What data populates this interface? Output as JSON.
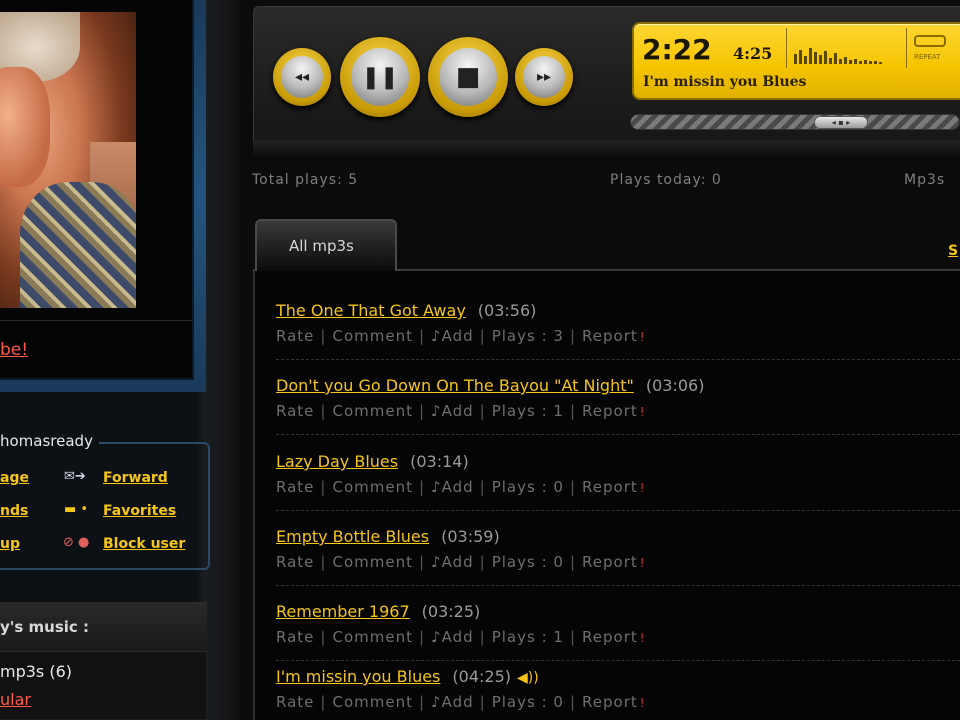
{
  "profile": {
    "photo_link": "be!",
    "username_fragment": "homasready",
    "actions": {
      "message": "age",
      "forward": "Forward",
      "friends": "nds",
      "favorites": "Favorites",
      "group": "up",
      "block": "Block user"
    },
    "music_title": "y's music :",
    "mp3s_count": "mp3s (6)",
    "popular": "ular"
  },
  "player": {
    "elapsed": "2:22",
    "duration": "4:25",
    "now_playing": "I'm missin you Blues",
    "repeat_label": "REPEAT",
    "progress_fraction": 0.53,
    "knob_label": "◂ ▪ ▸"
  },
  "stats": {
    "total_plays": "Total plays: 5",
    "plays_today": "Plays today: 0",
    "mp3s": "Mp3s"
  },
  "tab": {
    "label": "All mp3s",
    "side_link": "S"
  },
  "row_labels": {
    "rate": "Rate",
    "comment": "Comment",
    "add": "♪Add",
    "plays": "Plays :",
    "report": "Report",
    "bang": "!"
  },
  "songs": [
    {
      "title": "The One That Got Away",
      "duration": "(03:56)",
      "plays": "3"
    },
    {
      "title": "Don't you Go Down On The Bayou \"At Night\"",
      "duration": "(03:06)",
      "plays": "1"
    },
    {
      "title": "Lazy Day Blues",
      "duration": "(03:14)",
      "plays": "0"
    },
    {
      "title": "Empty Bottle Blues",
      "duration": "(03:59)",
      "plays": "0"
    },
    {
      "title": "Remember 1967",
      "duration": "(03:25)",
      "plays": "1"
    },
    {
      "title": "I'm missin you Blues",
      "duration": "(04:25)",
      "plays": "0",
      "playing": true
    }
  ],
  "colors": {
    "accent": "#f5c518",
    "link_red": "#ff5a4a",
    "lcd": "#f5c400"
  }
}
